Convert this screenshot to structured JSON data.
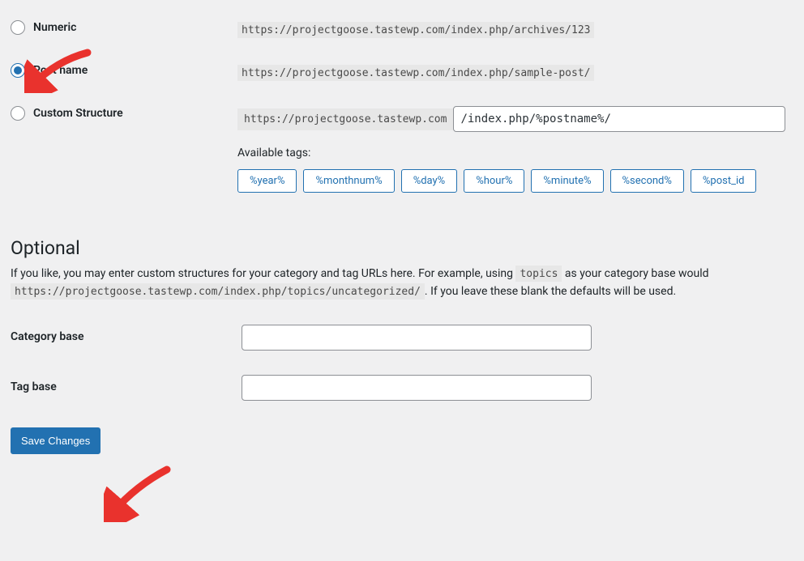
{
  "options": {
    "numeric": {
      "label": "Numeric",
      "example": "https://projectgoose.tastewp.com/index.php/archives/123"
    },
    "postname": {
      "label": "Post name",
      "example": "https://projectgoose.tastewp.com/index.php/sample-post/"
    },
    "custom": {
      "label": "Custom Structure",
      "prefix": "https://projectgoose.tastewp.com",
      "value": "/index.php/%postname%/"
    }
  },
  "available_tags_label": "Available tags:",
  "tags": [
    "%year%",
    "%monthnum%",
    "%day%",
    "%hour%",
    "%minute%",
    "%second%",
    "%post_id"
  ],
  "optional": {
    "heading": "Optional",
    "desc_pre": "If you like, you may enter custom structures for your category and tag URLs here. For example, using ",
    "desc_code1": "topics",
    "desc_mid": " as your category base would ",
    "desc_code2": "https://projectgoose.tastewp.com/index.php/topics/uncategorized/",
    "desc_post": ". If you leave these blank the defaults will be used."
  },
  "category_base_label": "Category base",
  "tag_base_label": "Tag base",
  "save_button": "Save Changes"
}
